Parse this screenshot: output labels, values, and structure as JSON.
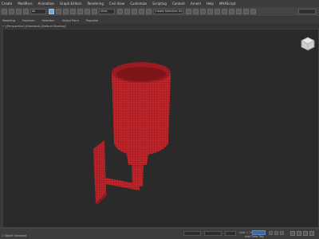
{
  "menu": {
    "items": [
      "Create",
      "Modifiers",
      "Animation",
      "Graph Editors",
      "Rendering",
      "Civil View",
      "Customize",
      "Scripting",
      "Content",
      "Arnold",
      "Help",
      "MAXScript"
    ]
  },
  "toolbar": {
    "filter_value": "All",
    "view_value": "View",
    "selection_set_placeholder": "Create Selection Se"
  },
  "ribbon": {
    "tabs": [
      "Modeling",
      "Freeform",
      "Selection",
      "Object Paint",
      "Populate"
    ]
  },
  "viewport": {
    "label": "[+] [Perspective] [Standard] [Default Shading]",
    "model_color": "#c0262a",
    "wire_color": "#7a1015"
  },
  "status": {
    "left_text": "1 Object Selected",
    "grid": "Grid = 10.0cm",
    "key_filter": "Add Time Tag",
    "auto_key": "Auto Key"
  },
  "colors": {
    "background": "#2a2a2a",
    "accent": "#6fa8dc"
  }
}
